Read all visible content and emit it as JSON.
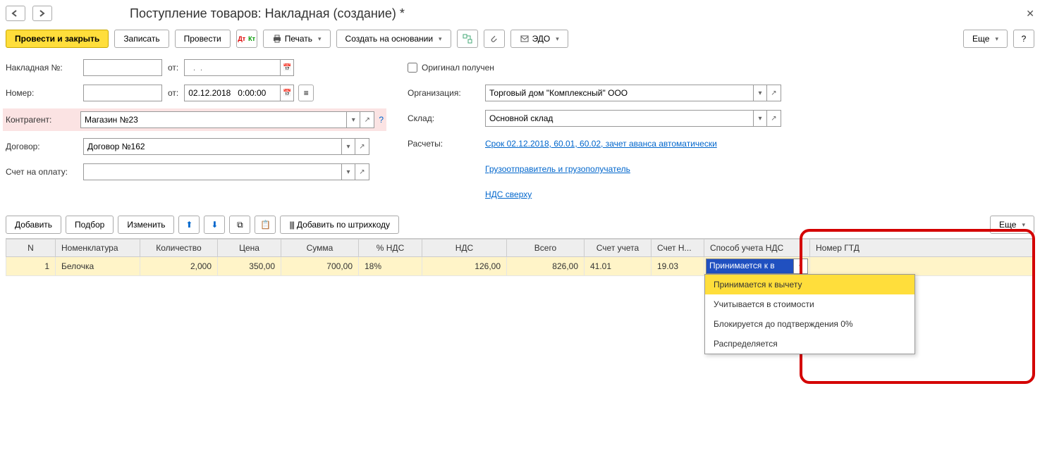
{
  "header": {
    "title": "Поступление товаров: Накладная (создание) *"
  },
  "toolbar": {
    "post_close": "Провести и закрыть",
    "save": "Записать",
    "post": "Провести",
    "print": "Печать",
    "create_based": "Создать на основании",
    "edo": "ЭДО",
    "more": "Еще",
    "help": "?"
  },
  "form": {
    "invoice_no_label": "Накладная №:",
    "from_label": "от:",
    "number_label": "Номер:",
    "date_value": "02.12.2018   0:00:00",
    "date_placeholder": "  .  .",
    "contractor_label": "Контрагент:",
    "contractor_value": "Магазин №23",
    "contract_label": "Договор:",
    "contract_value": "Договор №162",
    "account_label": "Счет на оплату:",
    "original_label": "Оригинал получен",
    "org_label": "Организация:",
    "org_value": "Торговый дом \"Комплексный\" ООО",
    "warehouse_label": "Склад:",
    "warehouse_value": "Основной склад",
    "calc_label": "Расчеты:",
    "calc_link": "Срок 02.12.2018, 60.01, 60.02, зачет аванса автоматически",
    "shipper_link": "Грузоотправитель и грузополучатель",
    "vat_link": "НДС сверху",
    "help_q": "?"
  },
  "tbl_toolbar": {
    "add": "Добавить",
    "select": "Подбор",
    "edit": "Изменить",
    "barcode": "Добавить по штрихкоду",
    "more2": "Еще"
  },
  "columns": [
    "N",
    "Номенклатура",
    "Количество",
    "Цена",
    "Сумма",
    "% НДС",
    "НДС",
    "Всего",
    "Счет учета",
    "Счет Н...",
    "Способ учета НДС",
    "Номер ГТД"
  ],
  "row": {
    "n": "1",
    "item": "Белочка",
    "qty": "2,000",
    "price": "350,00",
    "sum": "700,00",
    "vat_pct": "18%",
    "vat": "126,00",
    "total": "826,00",
    "acct": "41.01",
    "acct_n": "19.03",
    "vat_mode_sel": "Принимается к в"
  },
  "dropdown": {
    "items": [
      "Принимается к вычету",
      "Учитывается в стоимости",
      "Блокируется до подтверждения 0%",
      "Распределяется"
    ]
  }
}
